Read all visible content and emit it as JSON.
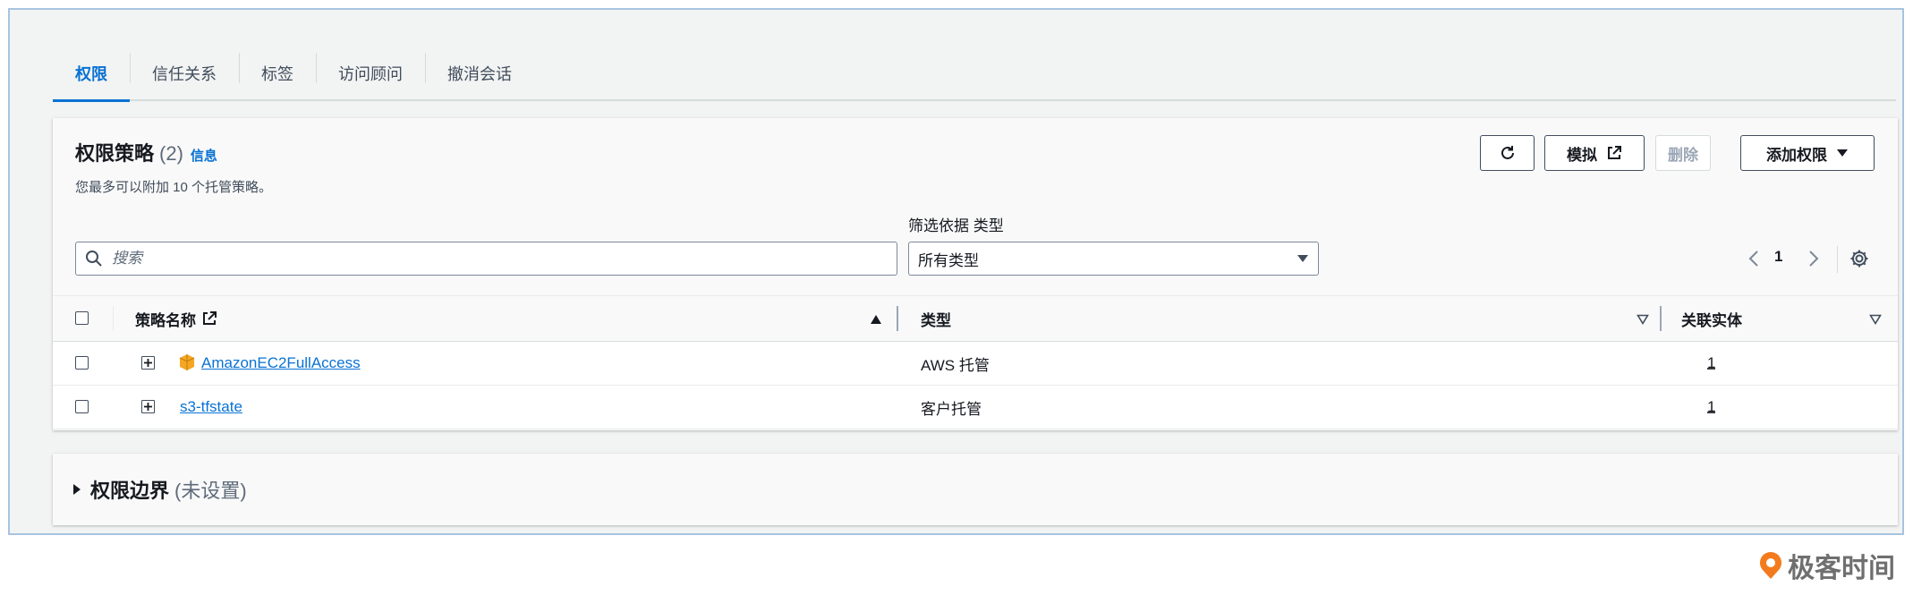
{
  "tabs": [
    {
      "label": "权限",
      "active": true
    },
    {
      "label": "信任关系",
      "active": false
    },
    {
      "label": "标签",
      "active": false
    },
    {
      "label": "访问顾问",
      "active": false
    },
    {
      "label": "撤消会话",
      "active": false
    }
  ],
  "panel": {
    "title": "权限策略",
    "count": "(2)",
    "info_label": "信息",
    "description": "您最多可以附加 10 个托管策略。",
    "buttons": {
      "simulate": "模拟",
      "delete": "删除",
      "add_permissions": "添加权限"
    },
    "filter_label": "筛选依据 类型",
    "search_placeholder": "搜索",
    "type_select_value": "所有类型",
    "page_number": "1"
  },
  "table": {
    "headers": {
      "name": "策略名称",
      "type": "类型",
      "entities": "关联实体"
    },
    "rows": [
      {
        "name": "AmazonEC2FullAccess",
        "type": "AWS 托管",
        "entities": "1",
        "aws_icon": true
      },
      {
        "name": "s3-tfstate",
        "type": "客户托管",
        "entities": "1",
        "aws_icon": false
      }
    ]
  },
  "boundary": {
    "title": "权限边界",
    "subtitle": "(未设置)"
  },
  "watermark": {
    "text": "极客时间"
  },
  "colors": {
    "accent": "#0972d3",
    "border": "#7d8998",
    "aws_orange": "#f5a623",
    "frame_border": "#a7c4e0"
  }
}
